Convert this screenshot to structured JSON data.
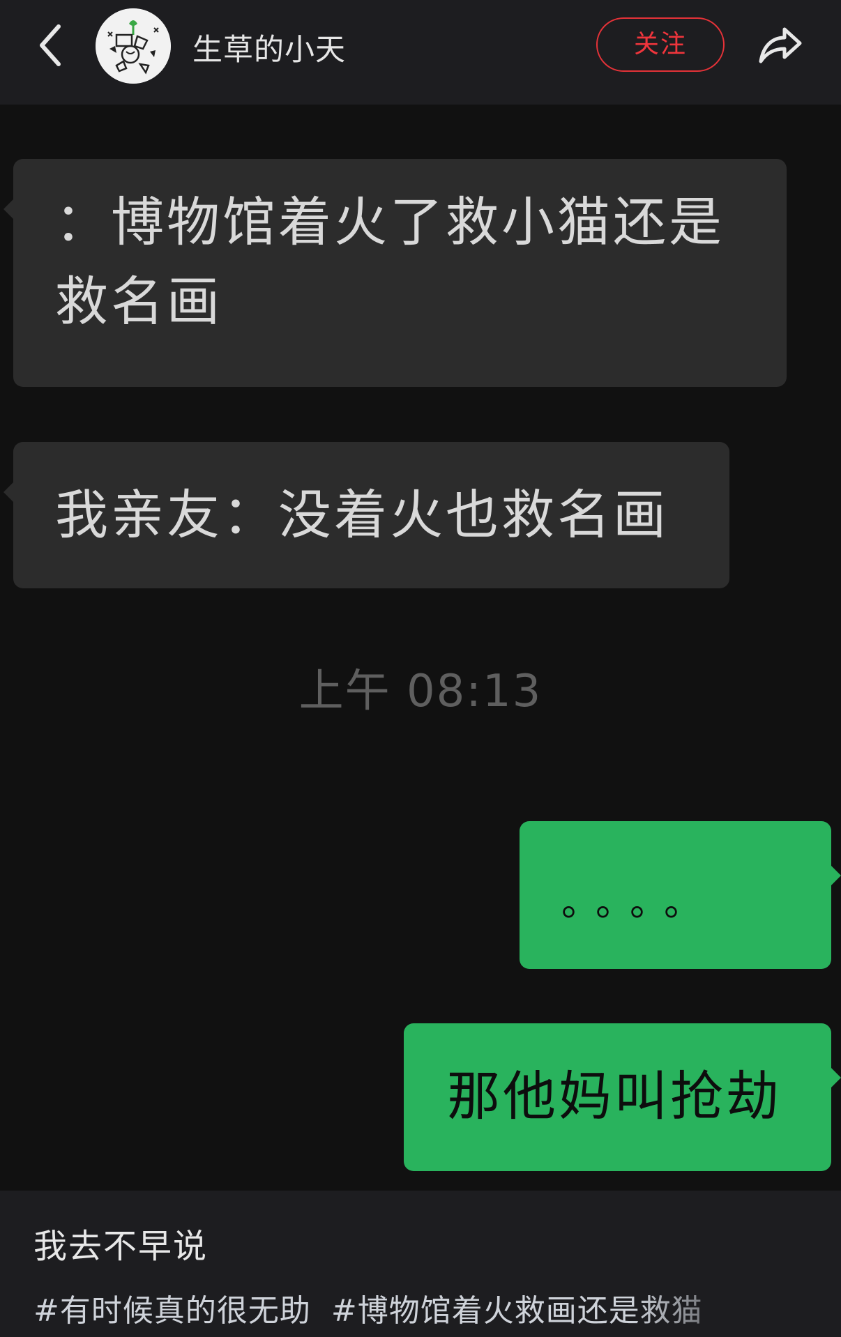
{
  "header": {
    "account_name": "生草的小天",
    "follow_label": "关注"
  },
  "chat": {
    "messages": [
      {
        "side": "incoming",
        "text": "：博物馆着火了救小猫还是救名画"
      },
      {
        "side": "incoming",
        "text": "我亲友：没着火也救名画"
      },
      {
        "side": "outgoing",
        "text": "。。。。"
      },
      {
        "side": "outgoing",
        "text": "那他妈叫抢劫"
      }
    ],
    "timestamp": "上午 08:13"
  },
  "post": {
    "caption": "我去不早说",
    "hashtags": [
      "#有时候真的很无助",
      "#博物馆着火救画还是救猫"
    ]
  },
  "colors": {
    "background": "#111111",
    "incoming_bubble": "#2c2c2c",
    "outgoing_bubble": "#29b35d",
    "follow_accent": "#e53238"
  },
  "icons": {
    "back": "chevron-left-icon",
    "share": "share-arrow-icon"
  }
}
